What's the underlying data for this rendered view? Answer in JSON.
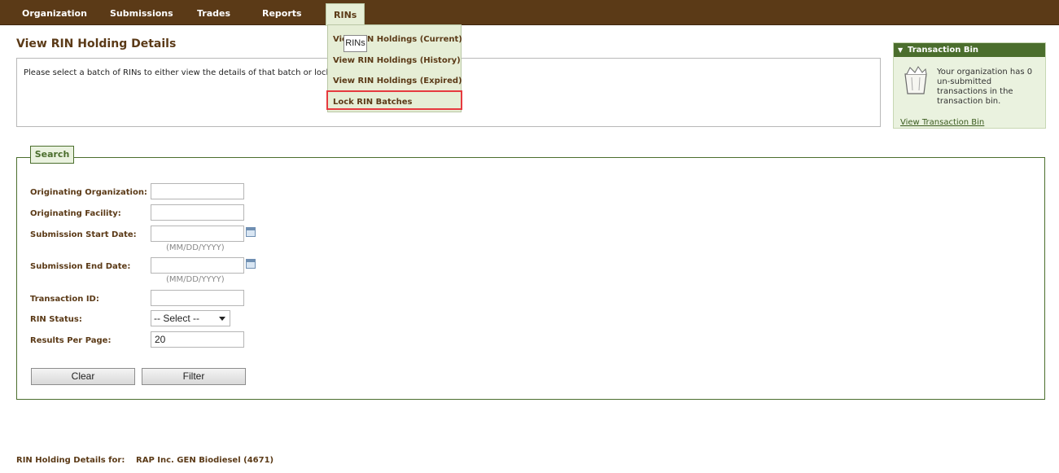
{
  "nav": {
    "items": [
      {
        "label": "Organization"
      },
      {
        "label": "Submissions"
      },
      {
        "label": "Trades"
      },
      {
        "label": "Reports"
      },
      {
        "label": "RINs"
      }
    ]
  },
  "page": {
    "title": "View RIN Holding Details",
    "instructions": "Please select a batch of RINs to either view the details of that batch or lock/unlock"
  },
  "rins_menu": {
    "items": [
      {
        "label": "View RIN Holdings (Current)"
      },
      {
        "label": "View RIN Holdings (History)"
      },
      {
        "label": "View RIN Holdings (Expired)"
      },
      {
        "label": "Lock RIN Batches"
      }
    ],
    "tooltip": "RINs"
  },
  "transaction_bin": {
    "title": "Transaction Bin",
    "message": "Your organization has 0 un-submitted transactions in the transaction bin.",
    "link": "View Transaction Bin"
  },
  "search": {
    "tab": "Search",
    "fields": {
      "originating_org": {
        "label": "Originating Organization:",
        "value": ""
      },
      "originating_facility": {
        "label": "Originating Facility:",
        "value": ""
      },
      "start_date": {
        "label": "Submission Start Date:",
        "value": "",
        "hint": "(MM/DD/YYYY)"
      },
      "end_date": {
        "label": "Submission End Date:",
        "value": "",
        "hint": "(MM/DD/YYYY)"
      },
      "transaction_id": {
        "label": "Transaction ID:",
        "value": ""
      },
      "rin_status": {
        "label": "RIN Status:",
        "selected": "-- Select --"
      },
      "results_per_page": {
        "label": "Results Per Page:",
        "value": "20"
      }
    },
    "clear_label": "Clear",
    "filter_label": "Filter"
  },
  "footer": {
    "label": "RIN Holding Details for:",
    "value": "RAP Inc. GEN Biodiesel (4671)"
  },
  "colors": {
    "nav_bg": "#5b3a17",
    "menu_bg": "#e6eed6",
    "highlight": "#e63a3f",
    "bin_header": "#4b6e2d"
  },
  "icons": [
    "calendar-icon",
    "transaction-bin-icon",
    "collapse-arrow-icon",
    "dropdown-caret-icon"
  ]
}
